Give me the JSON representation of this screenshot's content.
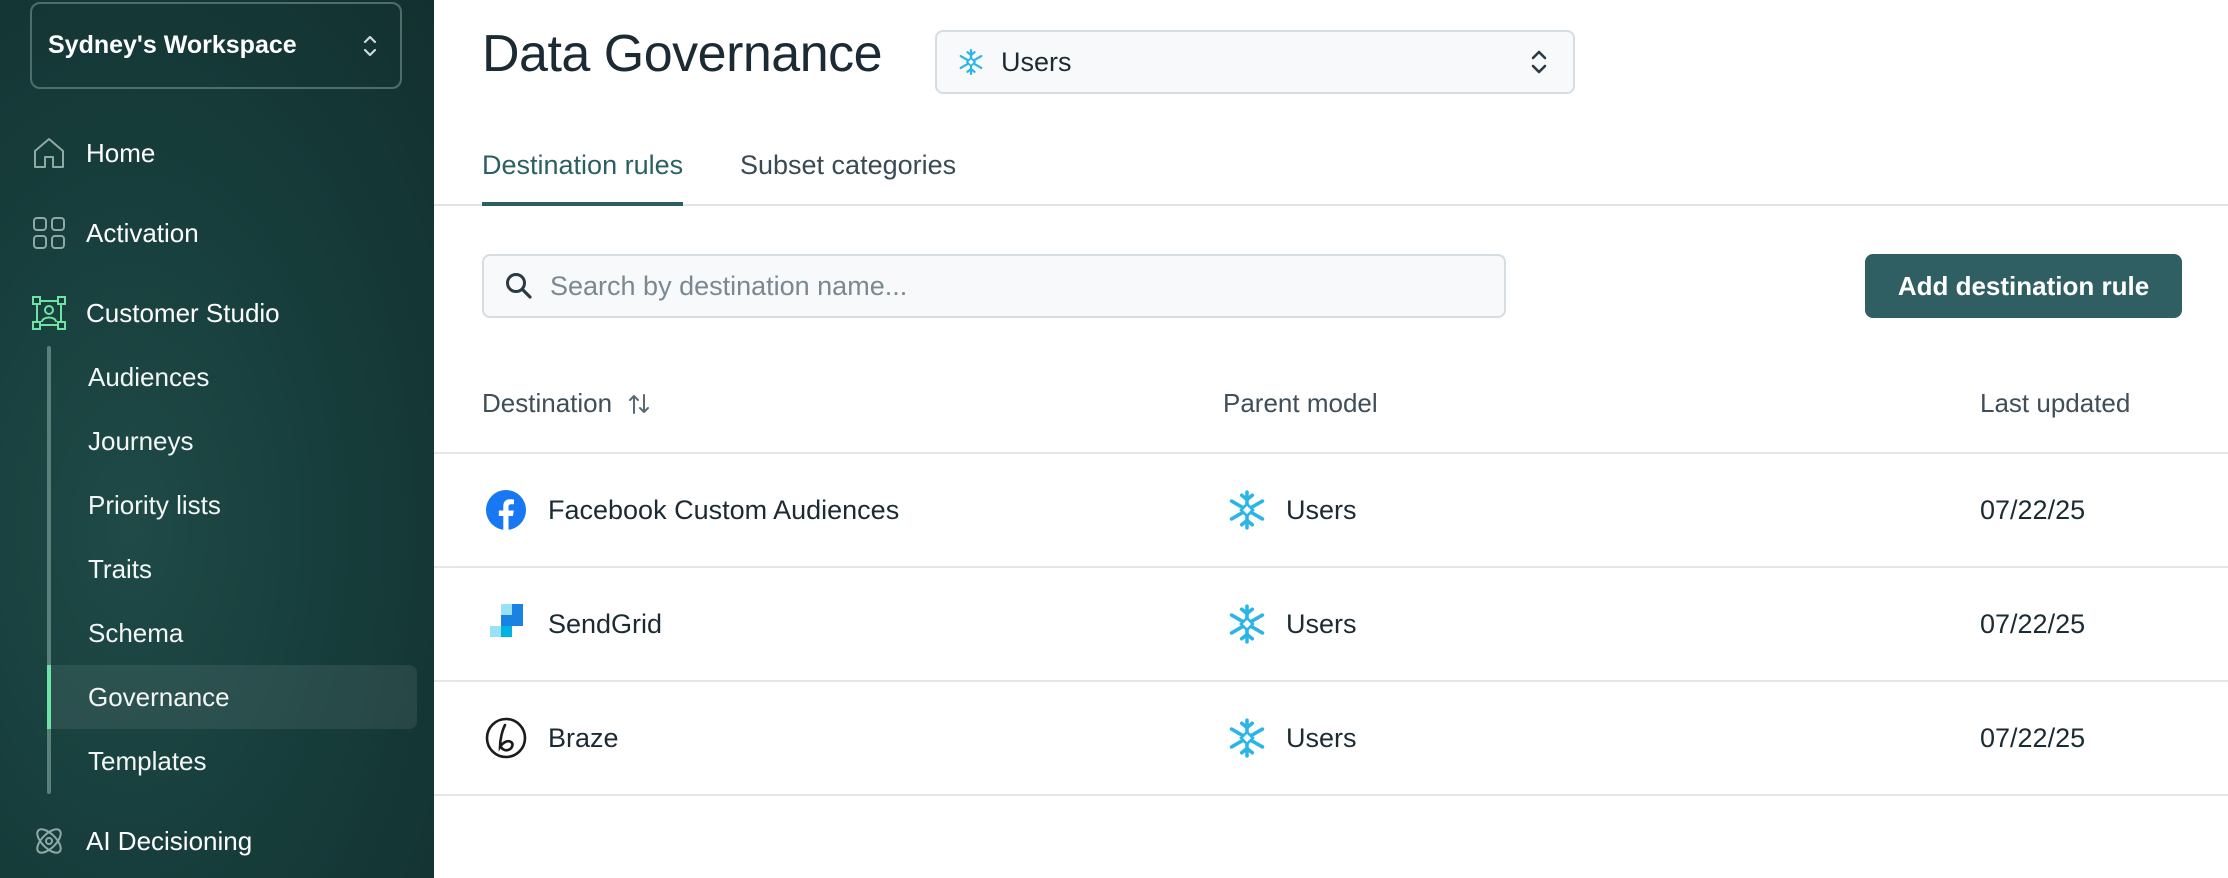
{
  "sidebar": {
    "workspace": "Sydney's Workspace",
    "nav": {
      "home": "Home",
      "activation": "Activation",
      "customer_studio": "Customer Studio",
      "ai_decisioning": "AI Decisioning"
    },
    "sub_items": [
      "Audiences",
      "Journeys",
      "Priority lists",
      "Traits",
      "Schema",
      "Governance",
      "Templates"
    ],
    "active_sub_item": "Governance"
  },
  "header": {
    "title": "Data Governance",
    "model_select": {
      "value": "Users",
      "icon": "snowflake-icon"
    }
  },
  "tabs": [
    {
      "label": "Destination rules",
      "active": true
    },
    {
      "label": "Subset categories",
      "active": false
    }
  ],
  "search": {
    "placeholder": "Search by destination name...",
    "value": ""
  },
  "add_button": "Add destination rule",
  "table": {
    "columns": {
      "destination": "Destination",
      "parent_model": "Parent model",
      "last_updated": "Last updated"
    },
    "rows": [
      {
        "destination": "Facebook Custom Audiences",
        "logo": "facebook-icon",
        "parent_model": "Users",
        "last_updated": "07/22/25"
      },
      {
        "destination": "SendGrid",
        "logo": "sendgrid-icon",
        "parent_model": "Users",
        "last_updated": "07/22/25"
      },
      {
        "destination": "Braze",
        "logo": "braze-icon",
        "parent_model": "Users",
        "last_updated": "07/22/25"
      }
    ]
  },
  "colors": {
    "sidebar_bg": "#173e3c",
    "accent": "#2f5f63",
    "active_indicator": "#6fe3a4",
    "snowflake": "#29b5e8",
    "facebook": "#1877f2"
  }
}
